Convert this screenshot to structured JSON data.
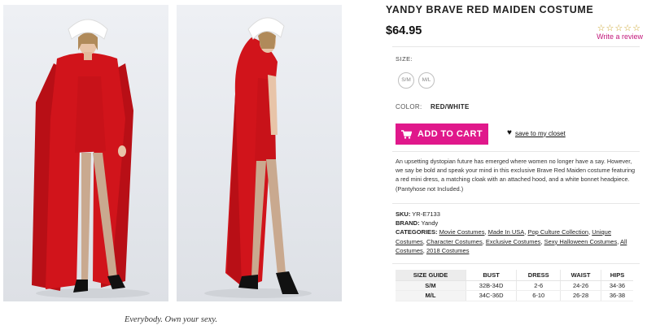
{
  "tagline": "Everybody. Own your sexy.",
  "product": {
    "title": "YANDY BRAVE RED MAIDEN COSTUME",
    "price": "$64.95",
    "rating_stars": "☆☆☆☆☆",
    "write_review": "Write a review",
    "size_label": "SIZE:",
    "sizes": [
      "S/M",
      "M/L"
    ],
    "color_label": "COLOR:",
    "color_value": "RED/WHITE",
    "add_to_cart": "ADD TO CART",
    "save_to_closet": "save to my closet",
    "description": "An upsetting dystopian future has emerged where women no longer have a say. However, we say be bold and speak your mind in this exclusive Brave Red Maiden costume featuring a red mini dress, a matching cloak with an attached hood, and a white bonnet headpiece. (Pantyhose not Included.)",
    "sku_label": "SKU:",
    "sku": "YR-E7133",
    "brand_label": "BRAND:",
    "brand": "Yandy",
    "categories_label": "CATEGORIES:",
    "categories": [
      "Movie Costumes",
      "Made In USA",
      "Pop Culture Collection",
      "Unique Costumes",
      "Character Costumes",
      "Exclusive Costumes",
      "Sexy Halloween Costumes",
      "All Costumes",
      "2018 Costumes"
    ]
  },
  "size_guide": {
    "headers": [
      "SIZE GUIDE",
      "BUST",
      "DRESS",
      "WAIST",
      "HIPS"
    ],
    "rows": [
      [
        "S/M",
        "32B-34D",
        "2-6",
        "24-26",
        "34-36"
      ],
      [
        "M/L",
        "34C-36D",
        "6-10",
        "26-28",
        "36-38"
      ]
    ]
  },
  "icons": {
    "cart": "cart-icon",
    "heart": "heart-icon",
    "star": "star-icon"
  },
  "colors": {
    "accent_pink": "#e0188b",
    "review_link": "#c2187a",
    "cloak_red": "#d1141b",
    "star_gold": "#c9a227"
  }
}
